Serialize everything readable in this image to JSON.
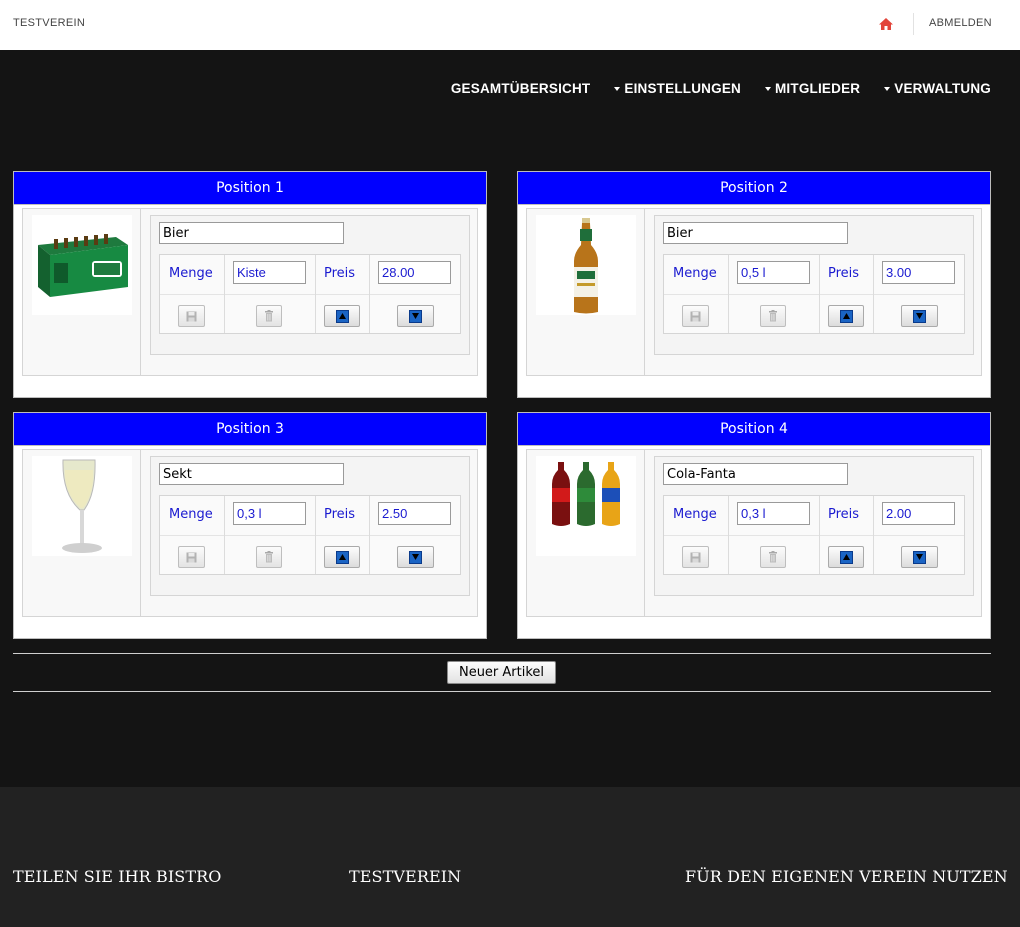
{
  "topbar": {
    "brand": "TESTVEREIN",
    "logout_label": "ABMELDEN",
    "home_icon_color": "#e2443a"
  },
  "nav": {
    "items": [
      {
        "label": "GESAMTÜBERSICHT",
        "dropdown": false
      },
      {
        "label": "EINSTELLUNGEN",
        "dropdown": true
      },
      {
        "label": "MITGLIEDER",
        "dropdown": true
      },
      {
        "label": "VERWALTUNG",
        "dropdown": true
      }
    ]
  },
  "positions": [
    {
      "title": "Position 1",
      "image": "beer-crate-image",
      "name": "Bier",
      "menge_label": "Menge",
      "menge": "Kiste",
      "preis_label": "Preis",
      "preis": "28.00"
    },
    {
      "title": "Position 2",
      "image": "beer-bottle-image",
      "name": "Bier",
      "menge_label": "Menge",
      "menge": "0,5 l",
      "preis_label": "Preis",
      "preis": "3.00"
    },
    {
      "title": "Position 3",
      "image": "champagne-glass-image",
      "name": "Sekt",
      "menge_label": "Menge",
      "menge": "0,3 l",
      "preis_label": "Preis",
      "preis": "2.50"
    },
    {
      "title": "Position 4",
      "image": "soda-bottles-image",
      "name": "Cola-Fanta",
      "menge_label": "Menge",
      "menge": "0,3 l",
      "preis_label": "Preis",
      "preis": "2.00"
    }
  ],
  "actions": {
    "new_article_label": "Neuer Artikel"
  },
  "footer": {
    "share": "TEILEN SIE IHR BISTRO",
    "club": "TESTVEREIN",
    "use": "FÜR DEN EIGENEN VEREIN NUTZEN"
  },
  "colors": {
    "header_blue": "#0000ff",
    "label_blue": "#1a1ad0",
    "page_bg": "#141414",
    "footer_bg": "#222222"
  }
}
